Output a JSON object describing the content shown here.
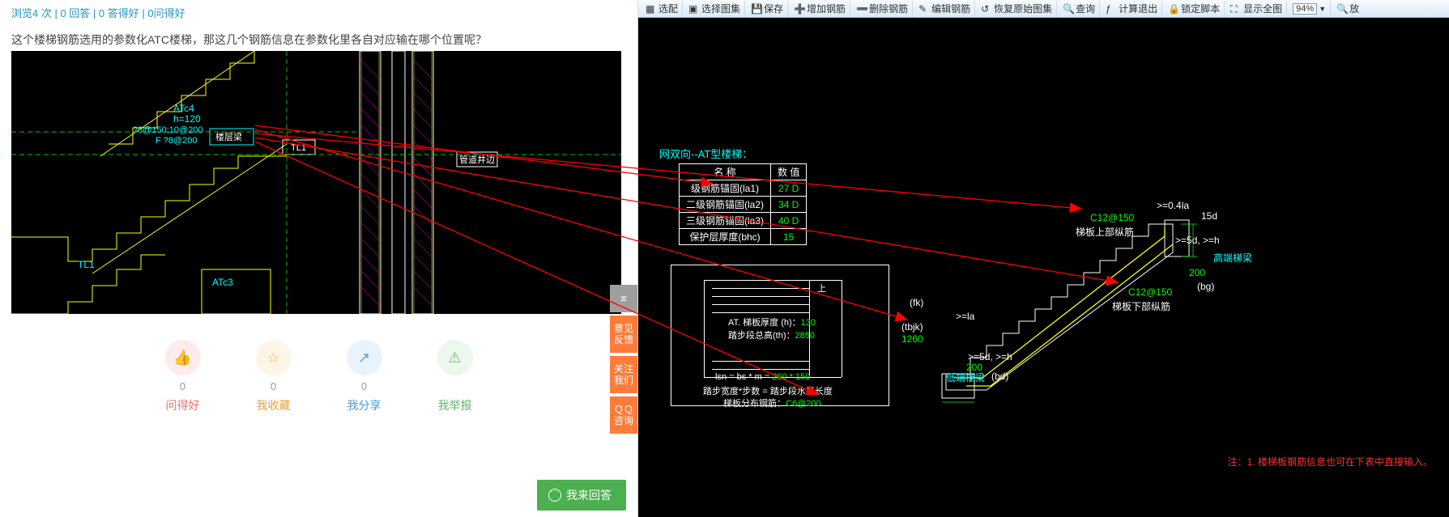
{
  "stats": {
    "views": "浏览4 次",
    "sep": " | ",
    "replies": "0 回答",
    "good_ans": "0 答得好",
    "good_q": "0问得好"
  },
  "question": "这个楼梯钢筋选用的参数化ATC楼梯，那这几个钢筋信息在参数化里各自对应输在哪个位置呢？",
  "left_cad": {
    "atc4": "ATc4",
    "h120": "h=120",
    "d1": "?8@150;10@200",
    "d2": "F ?8@200",
    "beam": "楼层梁",
    "tl1": "TL1",
    "pipe": "管道井边",
    "tl1b": "TL1",
    "atc3": "ATc3"
  },
  "actions": {
    "good_q": {
      "count": "0",
      "label": "问得好"
    },
    "fav": {
      "count": "0",
      "label": "我收藏"
    },
    "share": {
      "count": "0",
      "label": "我分享"
    },
    "report": {
      "label": "我举报"
    }
  },
  "side": {
    "top": "⌅",
    "feedback": "意见反馈",
    "follow": "关注我们",
    "qq": "ＱＱ咨询"
  },
  "answer_btn": "我来回答",
  "toolbar": {
    "peitao": "选配",
    "select": "选择图集",
    "save": "保存",
    "add": "增加钢筋",
    "del": "删除钢筋",
    "edit": "编辑钢筋",
    "restore": "恢复原始图集",
    "query": "查询",
    "calc": "计算退出",
    "lock": "锁定脚本",
    "full": "显示全图",
    "zoom": "94%",
    "zoom2": "放"
  },
  "right": {
    "title": "网双向--AT型楼梯：",
    "table": {
      "h_name": "名 称",
      "h_val": "数 值",
      "r1n": "级钢筋锚固(la1)",
      "r1v": "27 D",
      "r2n": "二级钢筋锚固(la2)",
      "r2v": "34 D",
      "r3n": "三级钢筋锚固(la3)",
      "r3v": "40 D",
      "r4n": "保护层厚度(bhc)",
      "r4v": "15"
    },
    "plan": {
      "up": "上",
      "thick_l": "AT. 梯板厚度 (h)：",
      "thick_v": "130",
      "total_l": "踏步段总高(th)：",
      "total_v": "2850",
      "fk": "(fk)",
      "tbjk": "(tbjk)",
      "tbjk_v": "1260"
    },
    "formulas": {
      "f1a": "lsn = bs * m = ",
      "f1b": "260 * 150",
      "f2": "踏步宽度*步数 = 踏步段水平长度",
      "f3a": "梯板分布钢筋：",
      "f3b": "C6@200"
    },
    "stair": {
      "top_bar": "C12@150",
      "top_lbl": "梯板上部纵筋",
      "bot_bar": "C12@150",
      "bot_lbl": "梯板下部纵筋",
      "la": ">=la",
      "d5h": ">=5d, >=h",
      "d5h2": ">=5d, >=h",
      "v04la": ">=0.4la",
      "v15d": "15d",
      "hi_beam": "高端梯梁",
      "lo_beam": "低端梯梁",
      "bg": "(bg)",
      "bd": "(bd)",
      "n200a": "200",
      "n200b": "200"
    },
    "note": "注：1. 楼梯板钢筋信息也可在下表中直接输入。"
  }
}
